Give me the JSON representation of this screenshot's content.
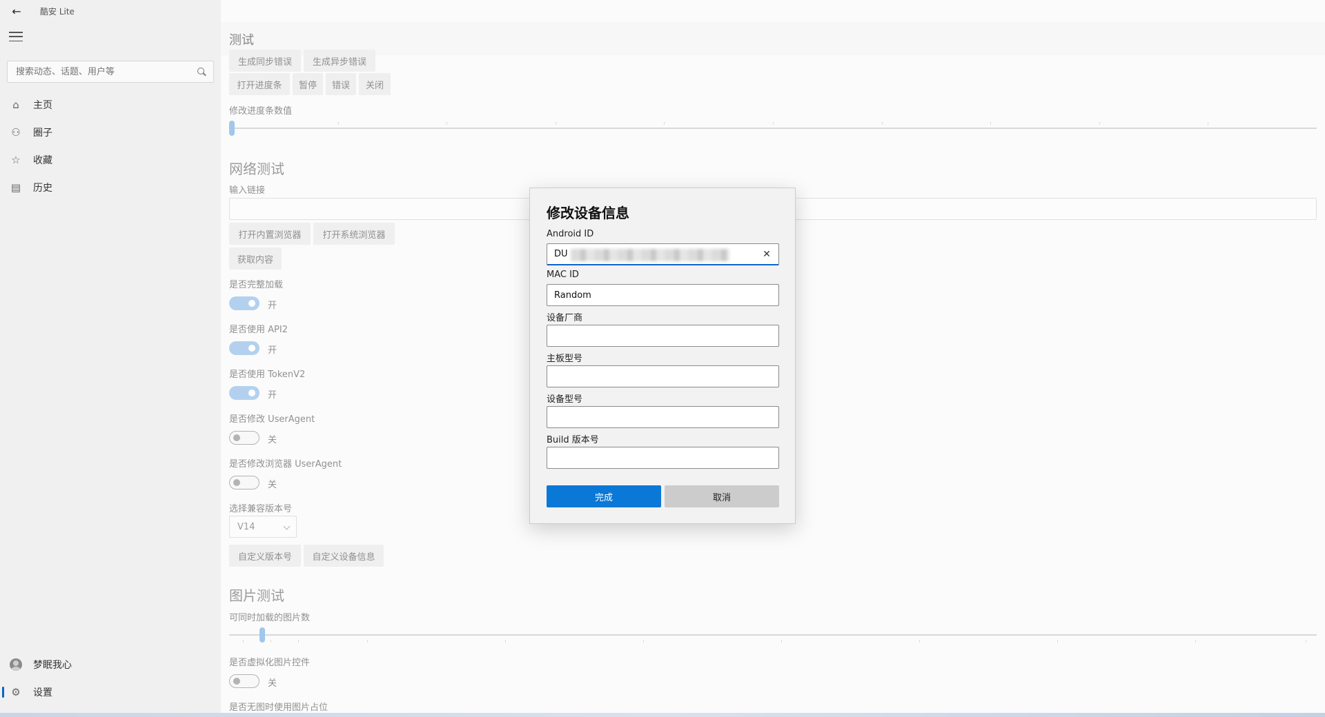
{
  "window": {
    "title": "酷安 Lite",
    "controls": [
      "minimize",
      "restore",
      "close"
    ]
  },
  "sidebar": {
    "search_placeholder": "搜索动态、话题、用户等",
    "items": [
      {
        "label": "主页",
        "icon": "home-icon"
      },
      {
        "label": "圈子",
        "icon": "people-icon"
      },
      {
        "label": "收藏",
        "icon": "star-icon"
      },
      {
        "label": "历史",
        "icon": "history-icon"
      }
    ],
    "user_name": "梦眠我心",
    "settings_label": "设置"
  },
  "page": {
    "title": "测试",
    "buttons_row1": [
      "生成同步错误",
      "生成异步错误"
    ],
    "buttons_row2": [
      "打开进度条",
      "暂停",
      "错误",
      "关闭"
    ],
    "progress_label": "修改进度条数值",
    "progress_value": 0,
    "network_section": "网络测试",
    "link_label": "输入链接",
    "link_value": "",
    "browser_buttons": [
      "打开内置浏览器",
      "打开系统浏览器"
    ],
    "fetch_button": "获取内容",
    "toggles": [
      {
        "label": "是否完整加载",
        "state": "开",
        "on": true
      },
      {
        "label": "是否使用 API2",
        "state": "开",
        "on": true
      },
      {
        "label": "是否使用 TokenV2",
        "state": "开",
        "on": true
      },
      {
        "label": "是否修改 UserAgent",
        "state": "关",
        "on": false
      },
      {
        "label": "是否修改浏览器 UserAgent",
        "state": "关",
        "on": false
      }
    ],
    "version_label": "选择兼容版本号",
    "version_value": "V14",
    "custom_buttons": [
      "自定义版本号",
      "自定义设备信息"
    ],
    "image_section": "图片测试",
    "image_count_label": "可同时加载的图片数",
    "virtualize_label": "是否虚拟化图片控件",
    "virtualize_state": "关",
    "placeholder_label": "是否无图时使用图片占位"
  },
  "dialog": {
    "title": "修改设备信息",
    "fields": [
      {
        "label": "Android ID",
        "value": "DU"
      },
      {
        "label": "MAC ID",
        "value": "Random"
      },
      {
        "label": "设备厂商",
        "value": ""
      },
      {
        "label": "主板型号",
        "value": ""
      },
      {
        "label": "设备型号",
        "value": ""
      },
      {
        "label": "Build 版本号",
        "value": ""
      }
    ],
    "primary_button": "完成",
    "secondary_button": "取消"
  },
  "colors": {
    "accent": "#0a78d6",
    "toggle_on": "#8ab8e6"
  }
}
